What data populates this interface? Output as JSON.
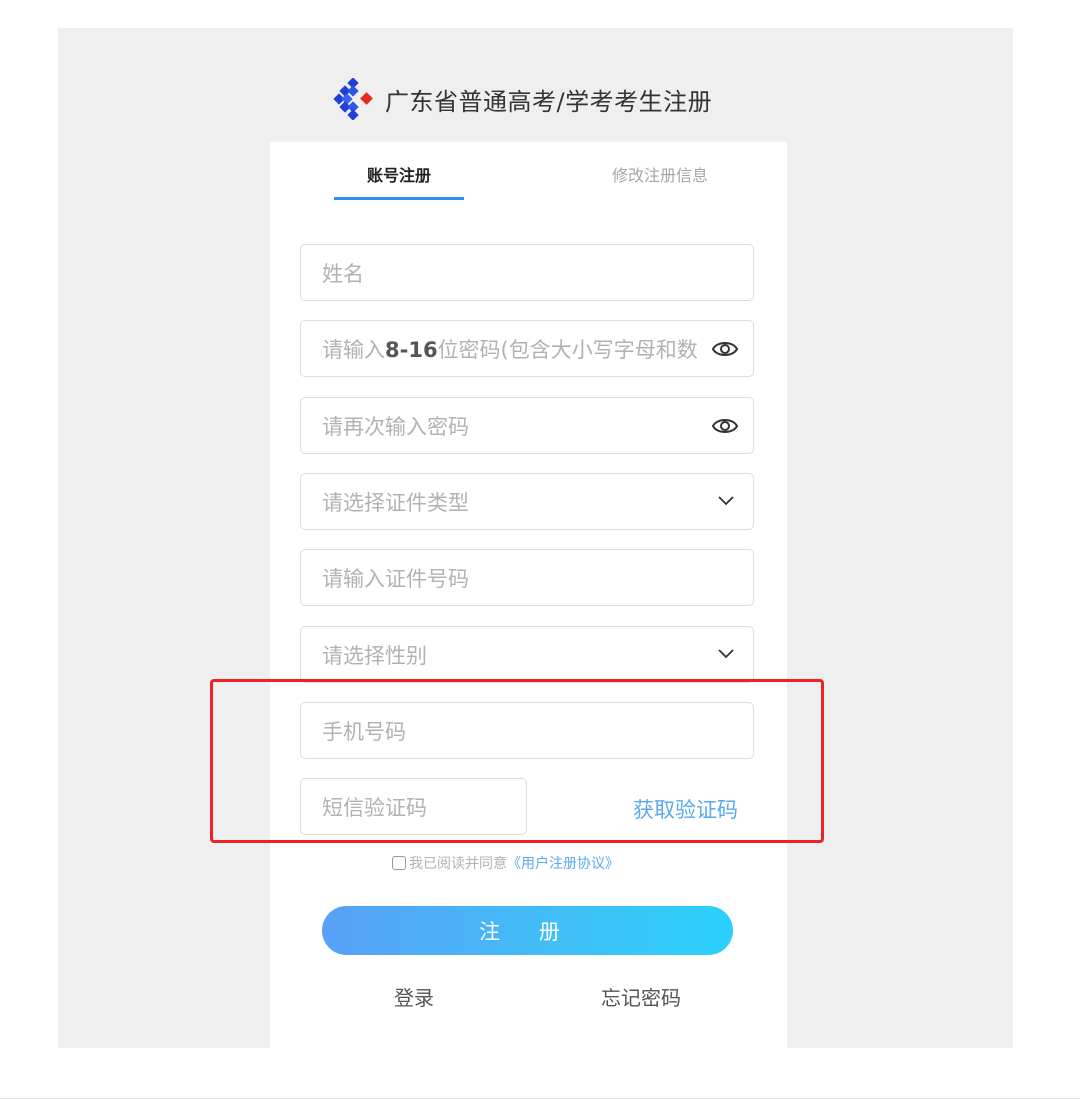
{
  "header": {
    "title": "广东省普通高考/学考考生注册",
    "logo_icon": "diamond-logo-icon",
    "logo_colors": [
      "#1f3fd6",
      "#e02b20"
    ]
  },
  "tabs": [
    {
      "label": "账号注册",
      "active": true
    },
    {
      "label": "修改注册信息",
      "active": false
    }
  ],
  "form": {
    "name_placeholder": "姓名",
    "password_placeholder_prefix": "请输入",
    "password_placeholder_bold": "8-16",
    "password_placeholder_suffix": "位密码(包含大小写字母和数",
    "confirm_password_placeholder": "请再次输入密码",
    "id_type_placeholder": "请选择证件类型",
    "id_number_placeholder": "请输入证件号码",
    "gender_placeholder": "请选择性别",
    "phone_placeholder": "手机号码",
    "sms_code_placeholder": "短信验证码",
    "get_code_label": "获取验证码",
    "eye_icon": "eye-icon",
    "chevron_icon": "chevron-down-icon"
  },
  "agreement": {
    "text": "我已阅读并同意",
    "link": "《用户注册协议》",
    "checked": false
  },
  "submit_label": "注 册",
  "links": {
    "login": "登录",
    "forgot_password": "忘记密码"
  },
  "colors": {
    "accent": "#2e8ef5",
    "link": "#5aaaf0",
    "highlight_box": "#ee2222",
    "button_gradient_start": "#3b8ff5",
    "button_gradient_end": "#05c8fb"
  }
}
